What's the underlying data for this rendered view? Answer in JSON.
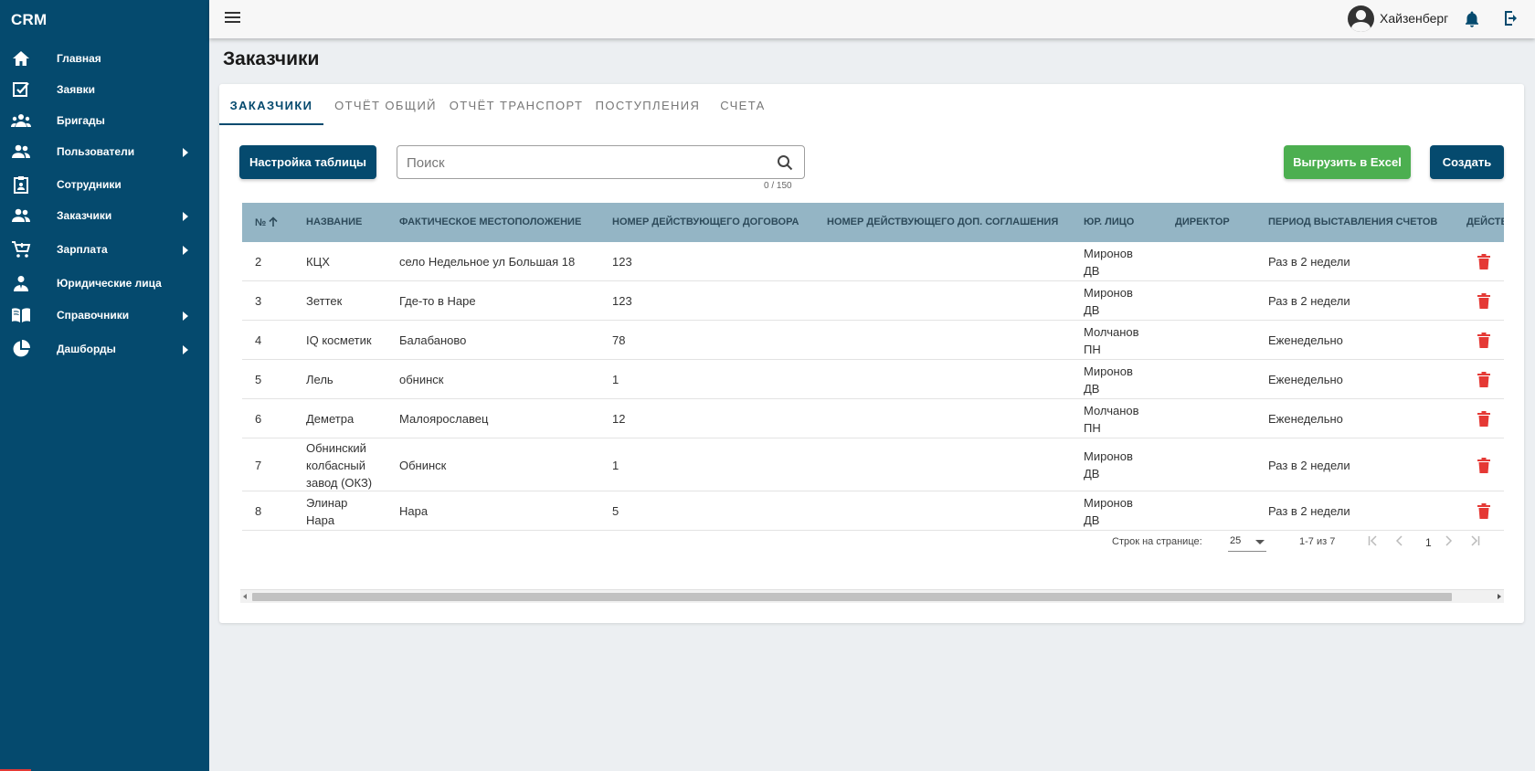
{
  "app": {
    "brand": "CRM"
  },
  "sidebar": {
    "items": [
      {
        "label": "Главная",
        "icon": "home-icon",
        "has_arrow": false
      },
      {
        "label": "Заявки",
        "icon": "checkbox-icon",
        "has_arrow": false
      },
      {
        "label": "Бригады",
        "icon": "group-icon",
        "has_arrow": false
      },
      {
        "label": "Пользователи",
        "icon": "people-icon",
        "has_arrow": true
      },
      {
        "label": "Сотрудники",
        "icon": "clipboard-icon",
        "has_arrow": false
      },
      {
        "label": "Заказчики",
        "icon": "people-icon",
        "has_arrow": true
      },
      {
        "label": "Зарплата",
        "icon": "cart-icon",
        "has_arrow": true
      },
      {
        "label": "Юридические лица",
        "icon": "person-tie-icon",
        "has_arrow": false
      },
      {
        "label": "Справочники",
        "icon": "book-icon",
        "has_arrow": true
      },
      {
        "label": "Дашборды",
        "icon": "pie-chart-icon",
        "has_arrow": true
      }
    ]
  },
  "topbar": {
    "user_name": "Хайзенберг"
  },
  "page": {
    "title": "Заказчики"
  },
  "tabs": [
    {
      "label": "ЗАКАЗЧИКИ",
      "active": true
    },
    {
      "label": "ОТЧЁТ ОБЩИЙ",
      "active": false
    },
    {
      "label": "ОТЧЁТ ТРАНСПОРТ",
      "active": false
    },
    {
      "label": "ПОСТУПЛЕНИЯ",
      "active": false
    },
    {
      "label": "СЧЕТА",
      "active": false
    }
  ],
  "toolbar": {
    "settings_label": "Настройка таблицы",
    "search_placeholder": "Поиск",
    "search_value": "",
    "search_counter": "0 / 150",
    "excel_label": "Выгрузить в Excel",
    "create_label": "Создать"
  },
  "table": {
    "columns": [
      "№",
      "НАЗВАНИЕ",
      "ФАКТИЧЕСКОЕ МЕСТОПОЛОЖЕНИЕ",
      "НОМЕР ДЕЙСТВУЮЩЕГО ДОГОВОРА",
      "НОМЕР ДЕЙСТВУЮЩЕГО ДОП. СОГЛАШЕНИЯ",
      "ЮР. ЛИЦО",
      "ДИРЕКТОР",
      "ПЕРИОД ВЫСТАВЛЕНИЯ СЧЕТОВ",
      "ДЕЙСТВ"
    ],
    "sort_column": "№",
    "sort_direction": "asc",
    "rows": [
      {
        "num": "2",
        "name": [
          "КЦХ"
        ],
        "location": "село Недельное ул Большая 18",
        "contract": "123",
        "addendum": "",
        "legal": [
          "Миронов",
          "ДВ"
        ],
        "director": "",
        "period": "Раз в 2 недели"
      },
      {
        "num": "3",
        "name": [
          "Зеттек"
        ],
        "location": "Где-то в Наре",
        "contract": "123",
        "addendum": "",
        "legal": [
          "Миронов",
          "ДВ"
        ],
        "director": "",
        "period": "Раз в 2 недели"
      },
      {
        "num": "4",
        "name": [
          "IQ косметик"
        ],
        "location": "Балабаново",
        "contract": "78",
        "addendum": "",
        "legal": [
          "Молчанов",
          "ПН"
        ],
        "director": "",
        "period": "Еженедельно"
      },
      {
        "num": "5",
        "name": [
          "Лель"
        ],
        "location": "обнинск",
        "contract": "1",
        "addendum": "",
        "legal": [
          "Миронов",
          "ДВ"
        ],
        "director": "",
        "period": "Еженедельно"
      },
      {
        "num": "6",
        "name": [
          "Деметра"
        ],
        "location": "Малоярославец",
        "contract": "12",
        "addendum": "",
        "legal": [
          "Молчанов",
          "ПН"
        ],
        "director": "",
        "period": "Еженедельно"
      },
      {
        "num": "7",
        "name": [
          "Обнинский",
          "колбасный",
          "завод (ОКЗ)"
        ],
        "location": "Обнинск",
        "contract": "1",
        "addendum": "",
        "legal": [
          "Миронов",
          "ДВ"
        ],
        "director": "",
        "period": "Раз в 2 недели"
      },
      {
        "num": "8",
        "name": [
          "Элинар",
          "Нара"
        ],
        "location": "Нара",
        "contract": "5",
        "addendum": "",
        "legal": [
          "Миронов",
          "ДВ"
        ],
        "director": "",
        "period": "Раз в 2 недели"
      }
    ]
  },
  "pagination": {
    "rows_per_page_label": "Строк на странице:",
    "rows_per_page": "25",
    "range": "1-7 из 7",
    "page": "1"
  },
  "colors": {
    "sidebar": "#054a6e",
    "primary": "#054a6e",
    "excel": "#4caf50",
    "header": "#94b5c5",
    "delete": "#e53935"
  }
}
